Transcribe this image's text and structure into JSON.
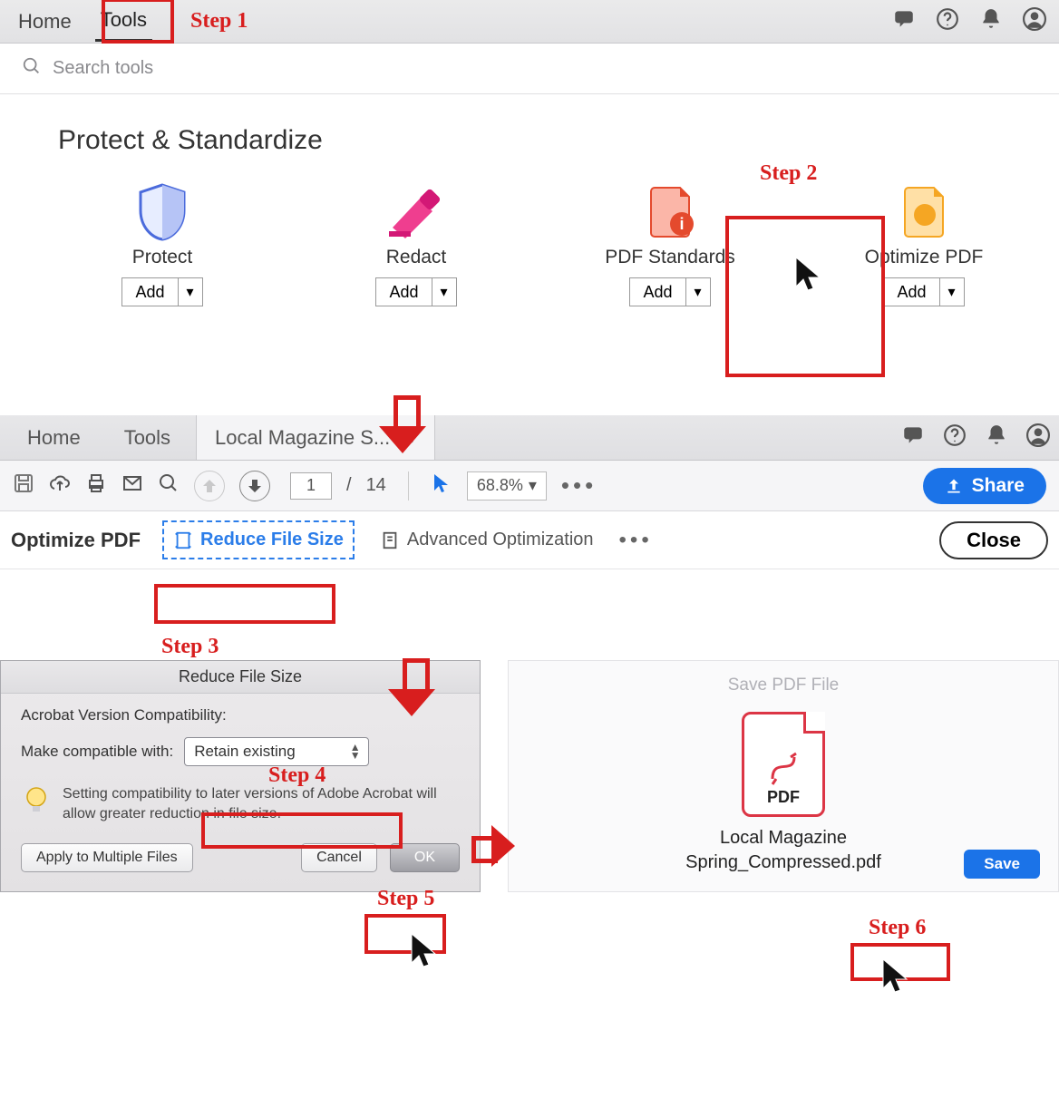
{
  "annotations": {
    "step1": "Step 1",
    "step2": "Step 2",
    "step3": "Step 3",
    "step4": "Step 4",
    "step5": "Step 5",
    "step6": "Step 6"
  },
  "panel1": {
    "tabs": {
      "home": "Home",
      "tools": "Tools"
    },
    "search_placeholder": "Search tools",
    "section_title": "Protect & Standardize",
    "tools": {
      "protect": "Protect",
      "redact": "Redact",
      "standards": "PDF Standards",
      "optimize": "Optimize PDF"
    },
    "add_label": "Add"
  },
  "panel2": {
    "tabs": {
      "home": "Home",
      "tools": "Tools",
      "doc": "Local Magazine S..."
    },
    "page_current": "1",
    "page_sep": "/",
    "page_total": "14",
    "zoom": "68.8%",
    "share": "Share",
    "sub": {
      "title": "Optimize PDF",
      "reduce": "Reduce File Size",
      "advanced": "Advanced Optimization",
      "close": "Close"
    }
  },
  "dialog": {
    "title": "Reduce File Size",
    "compat_label": "Acrobat Version Compatibility:",
    "make_label": "Make compatible with:",
    "select_value": "Retain existing",
    "tip": "Setting compatibility to later versions of Adobe Acrobat will allow greater reduction in file size.",
    "apply": "Apply to Multiple Files",
    "cancel": "Cancel",
    "ok": "OK"
  },
  "savepanel": {
    "title": "Save PDF File",
    "pdf_badge": "PDF",
    "filename_l1": "Local Magazine",
    "filename_l2": "Spring_Compressed.pdf",
    "save": "Save"
  }
}
